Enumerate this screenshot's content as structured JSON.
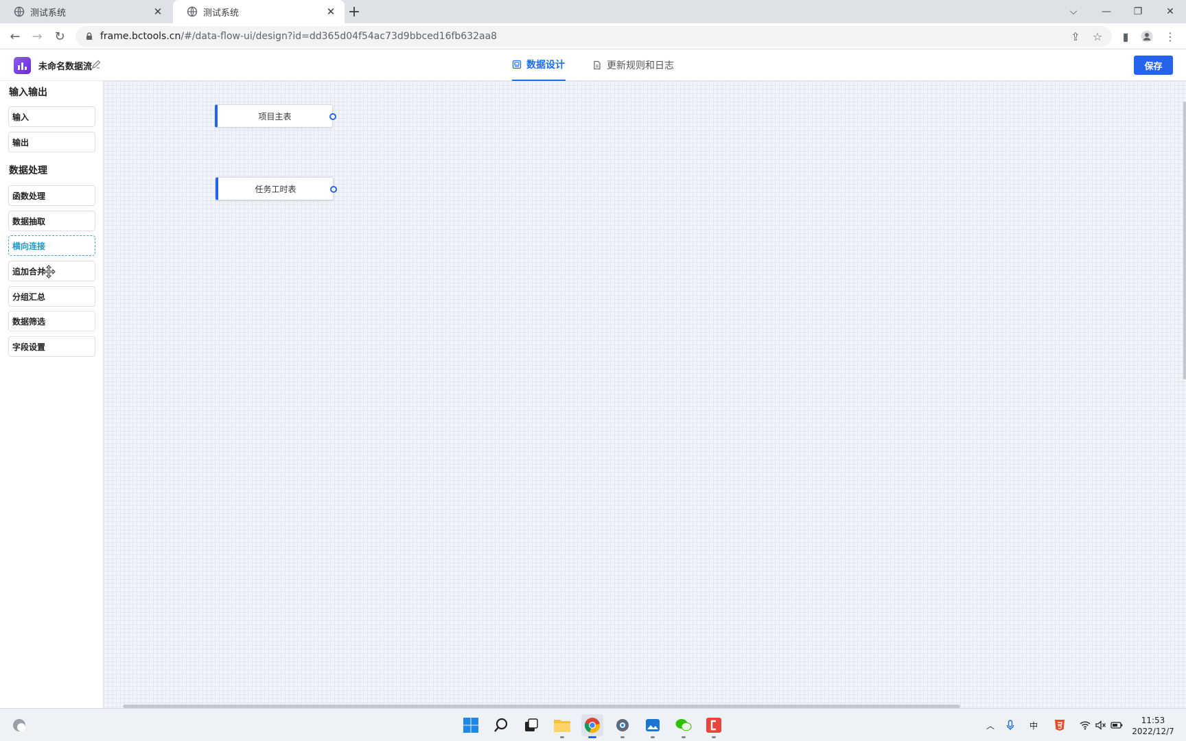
{
  "browser": {
    "tabs": [
      {
        "title": "测试系统",
        "active": false
      },
      {
        "title": "测试系统",
        "active": true
      }
    ],
    "url_host": "frame.bctools.cn",
    "url_path": "/#/data-flow-ui/design?id=dd365d04f54ac73d9bbced16fb632aa8"
  },
  "header": {
    "app_name": "未命名数据流",
    "tabs": [
      {
        "label": "数据设计",
        "active": true
      },
      {
        "label": "更新规则和日志",
        "active": false
      }
    ],
    "save_label": "保存",
    "accent_color": "#2463eb"
  },
  "sidebar": {
    "sections": [
      {
        "title": "输入输出",
        "items": [
          "输入",
          "输出"
        ]
      },
      {
        "title": "数据处理",
        "items": [
          "函数处理",
          "数据抽取",
          "横向连接",
          "追加合并",
          "分组汇总",
          "数据筛选",
          "字段设置"
        ]
      }
    ],
    "dragging_item": "横向连接"
  },
  "canvas": {
    "nodes": [
      {
        "label": "项目主表"
      },
      {
        "label": "任务工时表"
      }
    ]
  },
  "taskbar": {
    "apps": [
      "start-icon",
      "search-icon",
      "task-view-icon",
      "file-explorer-icon",
      "chrome-icon",
      "settings-icon",
      "photos-icon",
      "wechat-icon",
      "app-red-icon"
    ],
    "active_app": "chrome-icon",
    "tray": {
      "ime": "中"
    },
    "time": "11:53",
    "date": "2022/12/7"
  }
}
